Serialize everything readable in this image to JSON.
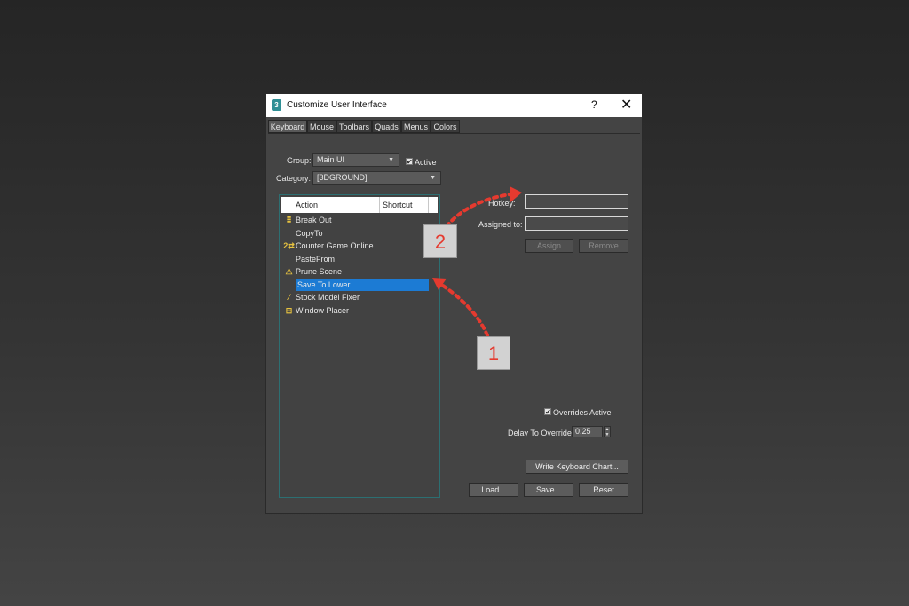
{
  "window": {
    "title": "Customize User Interface",
    "icon_label": "3",
    "help_label": "?",
    "close_label": "✕"
  },
  "tabs": [
    {
      "label": "Keyboard",
      "active": true
    },
    {
      "label": "Mouse"
    },
    {
      "label": "Toolbars"
    },
    {
      "label": "Quads"
    },
    {
      "label": "Menus"
    },
    {
      "label": "Colors"
    }
  ],
  "group": {
    "label": "Group:",
    "value": "Main UI"
  },
  "active_checkbox": {
    "label": "Active",
    "checked": true
  },
  "category": {
    "label": "Category:",
    "value": "[3DGROUND]"
  },
  "list": {
    "columns": [
      "Action",
      "Shortcut"
    ],
    "items": [
      {
        "label": "Break Out",
        "icon": "dotted-grid-icon"
      },
      {
        "label": "CopyTo",
        "icon": ""
      },
      {
        "label": "Counter Game Online",
        "icon": "2-2-icon"
      },
      {
        "label": "PasteFrom",
        "icon": ""
      },
      {
        "label": "Prune Scene",
        "icon": "warning-icon"
      },
      {
        "label": "Save To Lower",
        "icon": "",
        "selected": true
      },
      {
        "label": "Stock Model Fixer",
        "icon": "wand-icon"
      },
      {
        "label": "Window Placer",
        "icon": "window-grid-icon"
      }
    ]
  },
  "hotkey": {
    "label": "Hotkey:",
    "value": ""
  },
  "assigned_to": {
    "label": "Assigned to:",
    "value": ""
  },
  "buttons": {
    "assign": "Assign",
    "remove": "Remove",
    "write_chart": "Write Keyboard Chart...",
    "load": "Load...",
    "save": "Save...",
    "reset": "Reset"
  },
  "overrides_active": {
    "label": "Overrides Active",
    "checked": true
  },
  "delay": {
    "label": "Delay To Override:",
    "value": "0.25"
  },
  "callouts": [
    "1",
    "2"
  ],
  "colors": {
    "selection": "#1c7bd4",
    "arrow": "#e53a2f",
    "icon": "#e7c240"
  }
}
